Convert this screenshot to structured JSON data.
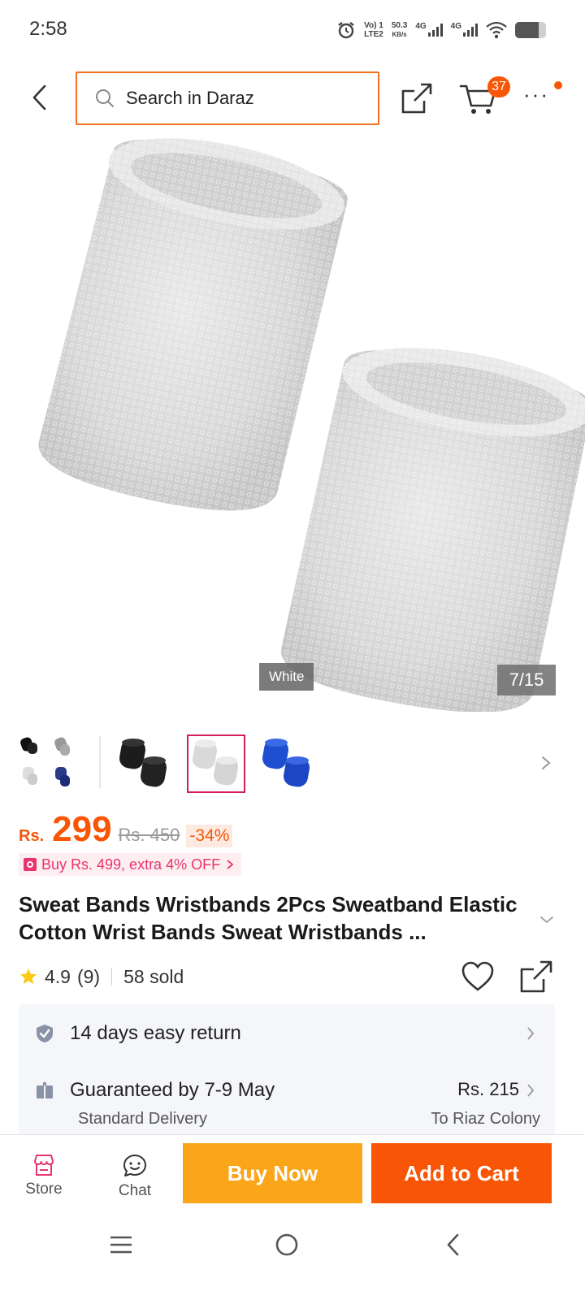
{
  "status_bar": {
    "time": "2:58",
    "volte": "Vo) 1",
    "lte": "LTE2",
    "speed_value": "50.3",
    "speed_unit": "KB/s",
    "net1": "4G",
    "net2": "4G",
    "battery_level": 0.75
  },
  "header": {
    "search_placeholder": "Search in Daraz",
    "cart_count": "37"
  },
  "gallery": {
    "variant_label": "White",
    "page_counter": "7/15"
  },
  "thumbnails": {
    "selected_index": 2,
    "items": [
      "multicolor",
      "black",
      "white",
      "blue"
    ]
  },
  "price": {
    "currency": "Rs.",
    "value": "299",
    "original": "Rs. 450",
    "discount": "-34%",
    "promo": "Buy Rs. 499, extra 4% OFF"
  },
  "product": {
    "title": "Sweat Bands Wristbands 2Pcs Sweatband Elastic Cotton Wrist Bands Sweat Wristbands ...",
    "rating": "4.9",
    "reviews": "(9)",
    "sold": "58 sold"
  },
  "info": {
    "return_text": "14 days easy return",
    "delivery_text": "Guaranteed by 7-9 May",
    "delivery_type": "Standard Delivery",
    "delivery_price": "Rs. 215",
    "delivery_location": "To Riaz Colony"
  },
  "bottom_bar": {
    "store_label": "Store",
    "chat_label": "Chat",
    "buy_now_label": "Buy Now",
    "add_to_cart_label": "Add to Cart"
  },
  "colors": {
    "brand_orange": "#f85606",
    "buy_now_yellow": "#faa51a",
    "promo_pink": "#e8346f"
  }
}
